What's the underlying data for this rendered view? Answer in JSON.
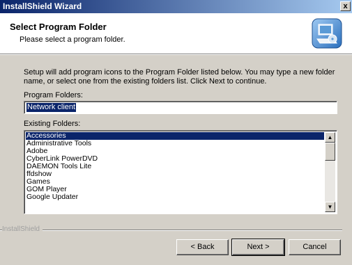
{
  "window": {
    "title": "InstallShield Wizard",
    "close_glyph": "x"
  },
  "header": {
    "title": "Select Program Folder",
    "subtitle": "Please select a program folder.",
    "icon": "installer-computer-icon"
  },
  "body": {
    "description": "Setup will add program icons to the Program Folder listed below.  You may type a new folder\nname, or select one from the existing folders list.  Click Next to continue.",
    "program_folder_label": "Program Folders:",
    "program_folder_value": "Network client",
    "existing_folders_label": "Existing Folders:",
    "existing_folders": [
      "Accessories",
      "Administrative Tools",
      "Adobe",
      "CyberLink PowerDVD",
      "DAEMON Tools Lite",
      "ffdshow",
      "Games",
      "GOM Player",
      "Google Updater"
    ],
    "selected_folder": "Accessories"
  },
  "footer": {
    "brand": "InstallShield",
    "back_label": "< Back",
    "next_label": "Next >",
    "cancel_label": "Cancel"
  },
  "colors": {
    "title_bar": "#0a246a",
    "selection": "#0a246a",
    "dialog_face": "#d4d0c8"
  }
}
